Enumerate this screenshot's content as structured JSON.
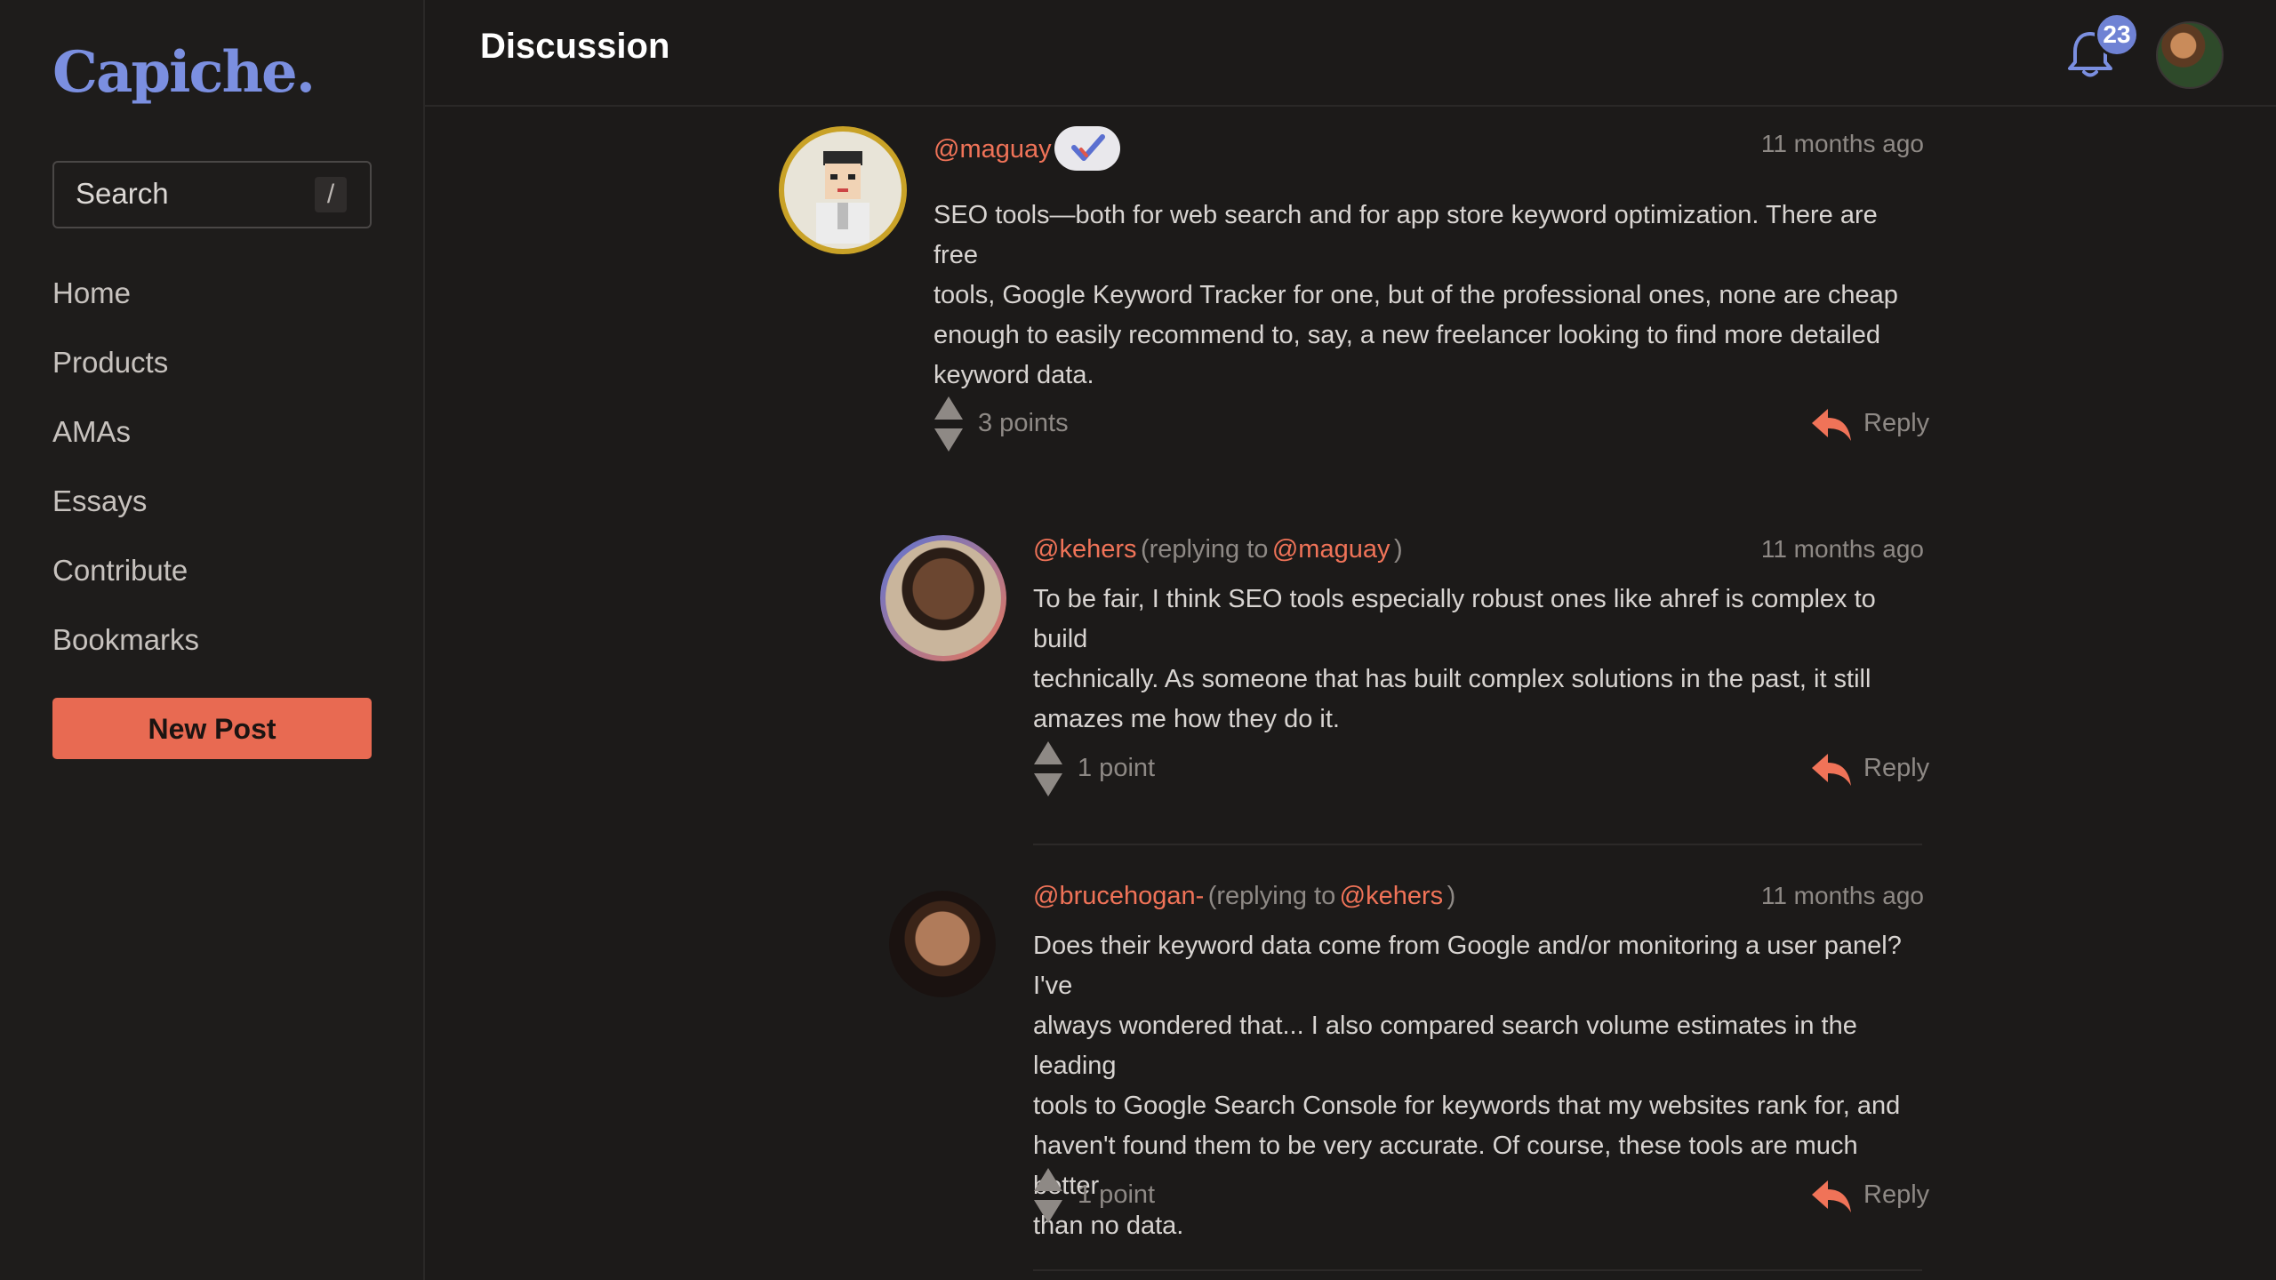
{
  "sidebar": {
    "logo": "Capiche.",
    "search": {
      "label": "Search",
      "shortcut": "/"
    },
    "nav": [
      "Home",
      "Products",
      "AMAs",
      "Essays",
      "Contribute",
      "Bookmarks"
    ],
    "new_post_label": "New Post"
  },
  "header": {
    "title": "Discussion",
    "notification_count": "23"
  },
  "comments": [
    {
      "username": "@maguay",
      "verified": true,
      "time": "11 months ago",
      "body_lines": [
        "SEO tools—both for web search and for app store keyword optimization. There are free",
        "tools, Google Keyword Tracker for one, but of the professional ones, none are cheap",
        "enough to easily recommend to, say, a new freelancer looking to find more detailed",
        "keyword data."
      ],
      "points": "3 points",
      "reply_label": "Reply"
    },
    {
      "username": "@kehers",
      "replying_prefix": "(replying to",
      "replying_to": "@maguay",
      "replying_suffix": ")",
      "time": "11 months ago",
      "body_lines": [
        "To be fair, I think SEO tools especially robust ones like ahref is complex to build",
        "technically. As someone that has built complex solutions in the past, it still",
        "amazes me how they do it."
      ],
      "points": "1 point",
      "reply_label": "Reply"
    },
    {
      "username": "@brucehogan-",
      "replying_prefix": "(replying to",
      "replying_to": "@kehers",
      "replying_suffix": ")",
      "time": "11 months ago",
      "body_lines": [
        "Does their keyword data come from Google and/or monitoring a user panel? I've",
        "always wondered that... I also compared search volume estimates in the leading",
        "tools to Google Search Console for keywords that my websites rank for, and",
        "haven't found them to be very accurate. Of course, these tools are much better",
        "than no data."
      ],
      "points": "1 point",
      "reply_label": "Reply"
    }
  ],
  "colors": {
    "accent": "#e86a52",
    "username": "#f07358",
    "logo": "#7b8fe0",
    "background": "#1c1a19"
  },
  "icons": [
    "bell-icon",
    "upvote-icon",
    "downvote-icon",
    "reply-icon",
    "verified-check-icon"
  ]
}
